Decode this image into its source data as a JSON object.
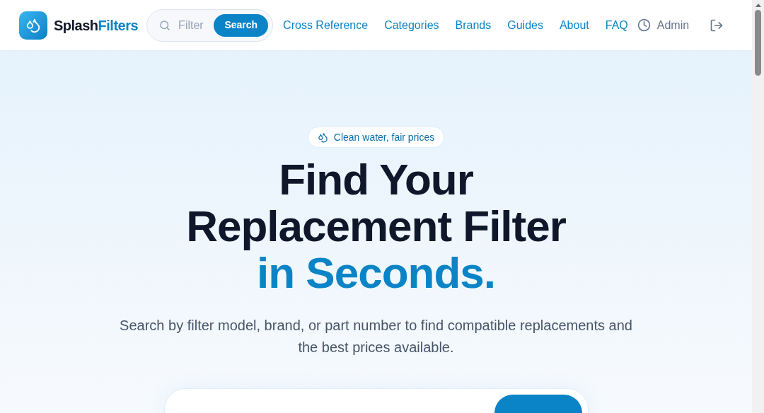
{
  "brand": {
    "name": "Splash",
    "accent": "Filters"
  },
  "search": {
    "placeholder": "Filter",
    "button": "Search"
  },
  "nav": [
    {
      "label": "Cross Reference"
    },
    {
      "label": "Categories"
    },
    {
      "label": "Brands"
    },
    {
      "label": "Guides"
    },
    {
      "label": "About"
    },
    {
      "label": "FAQ"
    }
  ],
  "user": {
    "label": "Admin"
  },
  "hero": {
    "badge": "Clean water, fair prices",
    "heading": [
      {
        "text": "Find Your",
        "accent": false
      },
      {
        "text": "Replacement Filter",
        "accent": false
      },
      {
        "text": "in Seconds.",
        "accent": true
      }
    ],
    "subtitle": "Search by filter model, brand, or part number to find compatible replacements and the best prices available."
  }
}
